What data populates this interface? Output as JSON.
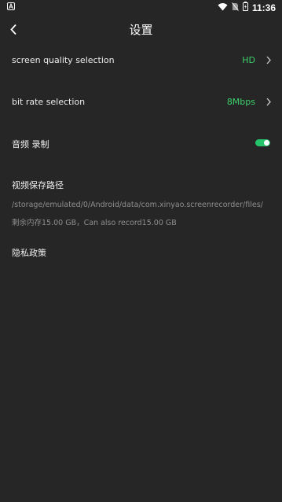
{
  "status_bar": {
    "time": "11:36",
    "icons": [
      "app-notification-icon",
      "wifi-icon",
      "no-sim-icon",
      "battery-icon"
    ]
  },
  "header": {
    "title": "设置"
  },
  "settings": {
    "quality": {
      "label": "screen quality selection",
      "value": "HD"
    },
    "bitrate": {
      "label": "bit rate selection",
      "value": "8Mbps"
    },
    "audio": {
      "label": "音频 录制",
      "enabled": true
    },
    "path": {
      "label": "视频保存路径",
      "value": "/storage/emulated/0/Android/data/com.xinyao.screenrecorder/files/",
      "storage": "剩余内存15.00 GB，Can also record15.00 GB"
    },
    "privacy": {
      "label": "隐私政策"
    }
  },
  "colors": {
    "background": "#262626",
    "accent": "#3ecf6c",
    "toggle_on": "#25c46a"
  }
}
